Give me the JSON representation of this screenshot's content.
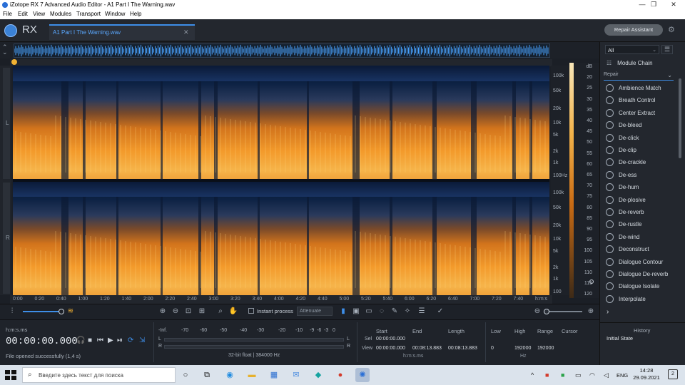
{
  "window": {
    "title": "iZotope RX 7 Advanced Audio Editor - A1 Part I The Warning.wav",
    "controls": [
      "—",
      "❐",
      "✕"
    ]
  },
  "menu": [
    "File",
    "Edit",
    "View",
    "Modules",
    "Transport",
    "Window",
    "Help"
  ],
  "header": {
    "logo_text": "RX",
    "file_tab": "A1 Part I The Warning.wav",
    "close": "✕",
    "repair_assistant": "Repair Assistant"
  },
  "channels": {
    "left": "L",
    "right": "R"
  },
  "freq_labels": [
    "100k",
    "50k",
    "20k",
    "10k",
    "5k",
    "2k",
    "1k",
    "100Hz"
  ],
  "freq_labels_r": [
    "100k",
    "50k",
    "20k",
    "10k",
    "5k",
    "2k",
    "1k",
    "100"
  ],
  "db_labels": [
    "dB",
    "20",
    "25",
    "30",
    "35",
    "40",
    "45",
    "50",
    "55",
    "60",
    "65",
    "70",
    "75",
    "80",
    "85",
    "90",
    "95",
    "100",
    "105",
    "110",
    "115",
    "120"
  ],
  "timeline": [
    "0:00",
    "0:20",
    "0:40",
    "1:00",
    "1:20",
    "1:40",
    "2:00",
    "2:20",
    "2:40",
    "3:00",
    "3:20",
    "3:40",
    "4:00",
    "4:20",
    "4:40",
    "5:00",
    "5:20",
    "5:40",
    "6:00",
    "6:20",
    "6:40",
    "7:00",
    "7:20",
    "7:40",
    "h:m:s"
  ],
  "toolbar": {
    "instant_process": "Instant process",
    "attenuate": "Attenuate"
  },
  "transport": {
    "format": "h:m:s.ms",
    "timecode": "00:00:00.000",
    "status": "File opened successfully (1,4 s)"
  },
  "meter": {
    "scale": [
      "-Inf.",
      "-70",
      "-60",
      "-50",
      "-40",
      "-30",
      "-20",
      "-10",
      "-9",
      "-6",
      "-3",
      "0"
    ],
    "l": "L",
    "r": "R",
    "info": "32-bit float | 384000 Hz"
  },
  "selection": {
    "headers": {
      "start": "Start",
      "end": "End",
      "length": "Length",
      "low": "Low",
      "high": "High",
      "range": "Range",
      "cursor": "Cursor"
    },
    "sel_label": "Sel",
    "view_label": "View",
    "sel": {
      "start": "00:00:00.000"
    },
    "view": {
      "start": "00:00:00.000",
      "end": "00:08:13.883",
      "length": "00:08:13.883",
      "low": "0",
      "high": "192000",
      "range": "192000"
    },
    "unit_time": "h:m:s.ms",
    "unit_freq": "Hz"
  },
  "right_panel": {
    "filter": "All",
    "module_chain": "Module Chain",
    "category": "Repair",
    "modules": [
      "Ambience Match",
      "Breath Control",
      "Center Extract",
      "De-bleed",
      "De-click",
      "De-clip",
      "De-crackle",
      "De-ess",
      "De-hum",
      "De-plosive",
      "De-reverb",
      "De-rustle",
      "De-wind",
      "Deconstruct",
      "Dialogue Contour",
      "Dialogue De-reverb",
      "Dialogue Isolate",
      "Interpolate"
    ],
    "more": "›"
  },
  "history": {
    "title": "History",
    "item": "Initial State"
  },
  "taskbar": {
    "search": "Введите здесь текст для поиска",
    "lang": "ENG",
    "time": "14:28",
    "date": "29.09.2021",
    "notifications": "2"
  }
}
